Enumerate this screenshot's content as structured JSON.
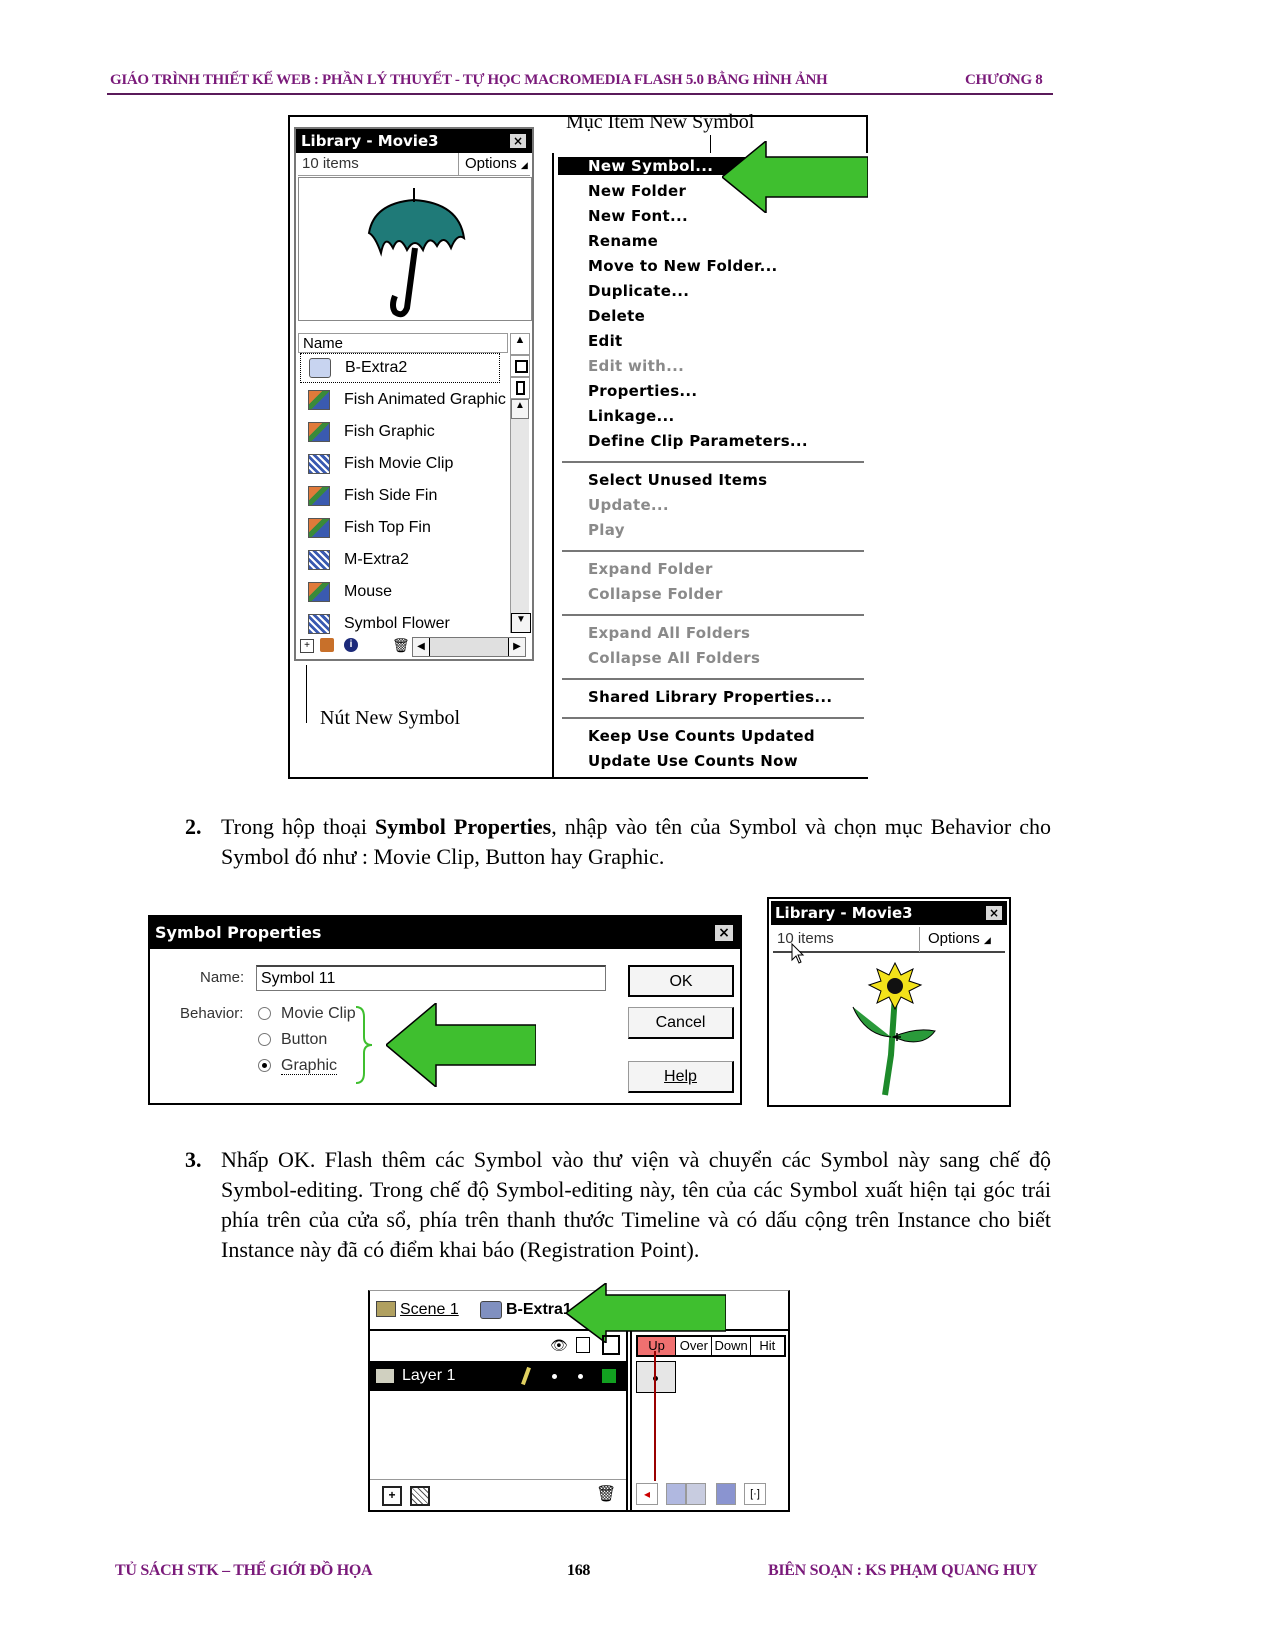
{
  "header": {
    "left": "GIÁO TRÌNH THIẾT KẾ WEB : PHẦN LÝ THUYẾT - TỰ HỌC MACROMEDIA FLASH 5.0 BẰNG HÌNH ẢNH",
    "right": "CHƯƠNG 8"
  },
  "figure1": {
    "library": {
      "title": "Library - Movie3",
      "close": "×",
      "item_count": "10 items",
      "options": "Options",
      "column_name": "Name",
      "items": [
        {
          "name": "B-Extra2",
          "type": "button",
          "icon": "button-symbol-icon"
        },
        {
          "name": "Fish Animated Graphic",
          "type": "graphic",
          "icon": "graphic-symbol-icon"
        },
        {
          "name": "Fish Graphic",
          "type": "graphic",
          "icon": "graphic-symbol-icon"
        },
        {
          "name": "Fish Movie Clip",
          "type": "movie",
          "icon": "movie-clip-symbol-icon"
        },
        {
          "name": "Fish Side Fin",
          "type": "graphic",
          "icon": "graphic-symbol-icon"
        },
        {
          "name": "Fish Top Fin",
          "type": "graphic",
          "icon": "graphic-symbol-icon"
        },
        {
          "name": "M-Extra2",
          "type": "movie",
          "icon": "movie-clip-symbol-icon"
        },
        {
          "name": "Mouse",
          "type": "graphic",
          "icon": "graphic-symbol-icon"
        },
        {
          "name": "Symbol Flower",
          "type": "movie",
          "icon": "movie-clip-symbol-icon"
        }
      ]
    },
    "callout_top": "Mục Item New Symbol",
    "callout_bottom": "Nút New Symbol",
    "menu": {
      "groups": [
        [
          {
            "label": "New Symbol...",
            "state": "highlighted"
          },
          {
            "label": "New Folder",
            "state": "enabled"
          },
          {
            "label": "New Font...",
            "state": "enabled"
          },
          {
            "label": "Rename",
            "state": "enabled"
          },
          {
            "label": "Move to New Folder...",
            "state": "enabled"
          },
          {
            "label": "Duplicate...",
            "state": "enabled"
          },
          {
            "label": "Delete",
            "state": "enabled"
          },
          {
            "label": "Edit",
            "state": "enabled"
          },
          {
            "label": "Edit with...",
            "state": "disabled"
          },
          {
            "label": "Properties...",
            "state": "enabled"
          },
          {
            "label": "Linkage...",
            "state": "enabled"
          },
          {
            "label": "Define Clip Parameters...",
            "state": "enabled"
          }
        ],
        [
          {
            "label": "Select Unused Items",
            "state": "enabled"
          },
          {
            "label": "Update...",
            "state": "disabled"
          },
          {
            "label": "Play",
            "state": "disabled"
          }
        ],
        [
          {
            "label": "Expand Folder",
            "state": "disabled"
          },
          {
            "label": "Collapse Folder",
            "state": "disabled"
          }
        ],
        [
          {
            "label": "Expand All Folders",
            "state": "disabled"
          },
          {
            "label": "Collapse All Folders",
            "state": "disabled"
          }
        ],
        [
          {
            "label": "Shared Library Properties...",
            "state": "enabled"
          }
        ],
        [
          {
            "label": "Keep Use Counts Updated",
            "state": "enabled"
          },
          {
            "label": "Update Use Counts Now",
            "state": "enabled"
          }
        ]
      ]
    }
  },
  "step2": {
    "number": "2.",
    "text_before": "Trong hộp thoại ",
    "bold": "Symbol Properties",
    "text_after": ", nhập vào tên của Symbol và chọn mục Behavior cho Symbol đó như : Movie Clip, Button hay Graphic."
  },
  "figure2": {
    "dialog": {
      "title": "Symbol Properties",
      "close": "×",
      "name_label": "Name:",
      "name_value": "Symbol 11",
      "behavior_label": "Behavior:",
      "options": [
        {
          "label": "Movie Clip",
          "selected": false
        },
        {
          "label": "Button",
          "selected": false
        },
        {
          "label": "Graphic",
          "selected": true
        }
      ],
      "ok": "OK",
      "cancel": "Cancel",
      "help": "Help"
    },
    "library": {
      "title": "Library - Movie3",
      "close": "×",
      "item_count": "10 items",
      "options": "Options"
    }
  },
  "step3": {
    "number": "3.",
    "text": "Nhấp OK. Flash thêm các Symbol vào thư viện và chuyển các Symbol này sang chế độ Symbol-editing. Trong chế độ Symbol-editing này, tên của các Symbol xuất hiện tại góc trái phía trên của cửa sổ, phía trên thanh thước Timeline và có dấu cộng trên Instance cho biết Instance này đã có điểm khai báo (Registration Point)."
  },
  "figure3": {
    "scene": "Scene 1",
    "symbol": "B-Extra1",
    "layer": "Layer 1",
    "frames": [
      "Up",
      "Over",
      "Down",
      "Hit"
    ],
    "active_frame": "Up"
  },
  "footer": {
    "left": "TỦ SÁCH STK – THẾ GIỚI ĐỒ HỌA",
    "page": "168",
    "right": "BIÊN SOẠN : KS PHẠM QUANG HUY"
  },
  "colors": {
    "header_purple": "#7a1a7a",
    "arrow_green": "#3fbf2f",
    "frame_red": "#f07070"
  }
}
